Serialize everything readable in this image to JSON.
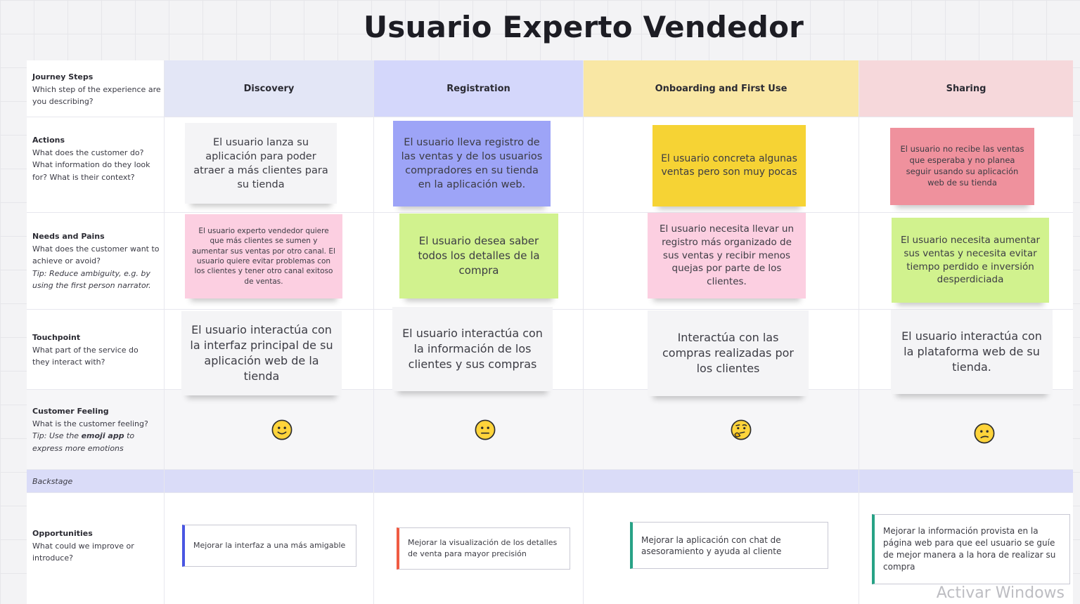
{
  "title": "Usuario Experto Vendedor",
  "rows": {
    "journey": {
      "heading": "Journey Steps",
      "description": "Which step of the experience are you describing?"
    },
    "actions": {
      "heading": "Actions",
      "description": "What does the customer do? What information do they look for? What is their context?"
    },
    "needs": {
      "heading": "Needs and Pains",
      "description": "What does the customer want to achieve or avoid?",
      "tip": "Tip: Reduce ambiguity, e.g. by using the first person narrator."
    },
    "touchpoint": {
      "heading": "Touchpoint",
      "description": "What part of the service do they interact with?"
    },
    "feeling": {
      "heading": "Customer Feeling",
      "description": "What is the customer feeling?",
      "tip_prefix": "Tip: Use the ",
      "tip_bold": "emoji app",
      "tip_suffix": " to express more emotions"
    },
    "backstage": {
      "label": "Backstage"
    },
    "opportunities": {
      "heading": "Opportunities",
      "description": "What could we improve or introduce?"
    }
  },
  "steps": [
    {
      "label": "Discovery",
      "color": "#e3e6f6"
    },
    {
      "label": "Registration",
      "color": "#d4d7fb"
    },
    {
      "label": "Onboarding and First Use",
      "color": "#f9e7a4"
    },
    {
      "label": "Sharing",
      "color": "#f6d8db"
    }
  ],
  "actions": [
    {
      "text": "El usuario lanza su aplicación para poder atraer a más clientes para su tienda",
      "color": "#f4f4f6"
    },
    {
      "text": "El usuario lleva registro de las ventas y de los usuarios compradores en su tienda en la aplicación web.",
      "color": "#9da4f7"
    },
    {
      "text": "El usuario concreta algunas ventas pero son muy pocas",
      "color": "#f6d334"
    },
    {
      "text": "El usuario no recibe las ventas que esperaba y no planea seguir usando su aplicación web de su tienda",
      "color": "#ef919d"
    }
  ],
  "needs": [
    {
      "text": "El usuario experto vendedor quiere que más clientes se sumen y aumentar sus ventas por otro canal. El usuario quiere evitar problemas con los clientes y tener otro canal exitoso de ventas.",
      "color": "#fccfe1"
    },
    {
      "text": "El usuario desea saber todos los detalles de la compra",
      "color": "#d1f28e"
    },
    {
      "text": "El usuario necesita llevar un registro más organizado de sus ventas y recibir menos quejas por parte de los clientes.",
      "color": "#fccfe1"
    },
    {
      "text": "El usuario necesita aumentar sus ventas y necesita evitar tiempo perdido e inversión desperdiciada",
      "color": "#d1f28e"
    }
  ],
  "touchpoints": [
    {
      "text": "El usuario interactúa con la interfaz principal de su aplicación web de la tienda",
      "color": "#f4f4f6"
    },
    {
      "text": "El usuario interactúa con la información de los clientes y sus compras",
      "color": "#f4f4f6"
    },
    {
      "text": "Interactúa con las compras realizadas por los clientes",
      "color": "#f4f4f6"
    },
    {
      "text": "El usuario interactúa con la plataforma web de su tienda.",
      "color": "#f4f4f6"
    }
  ],
  "feelings": [
    {
      "icon": "slightly-smiling-face-icon"
    },
    {
      "icon": "neutral-face-icon"
    },
    {
      "icon": "thinking-face-icon"
    },
    {
      "icon": "confused-face-icon"
    }
  ],
  "opportunities": [
    {
      "text": "Mejorar la interfaz a una más amigable",
      "color": "#4a56e2"
    },
    {
      "text": "Mejorar la visualización de los detalles de venta para mayor precisión",
      "color": "#f05b43"
    },
    {
      "text": "Mejorar la aplicación con chat de asesoramiento y ayuda al cliente",
      "color": "#27a286"
    },
    {
      "text": "Mejorar la información provista en la página web para que eel usuario se guíe de mejor manera a la hora de realizar su compra",
      "color": "#27a286"
    }
  ],
  "colors": {
    "backstage_band": "#dadcf8"
  },
  "watermark": "Activar Windows"
}
